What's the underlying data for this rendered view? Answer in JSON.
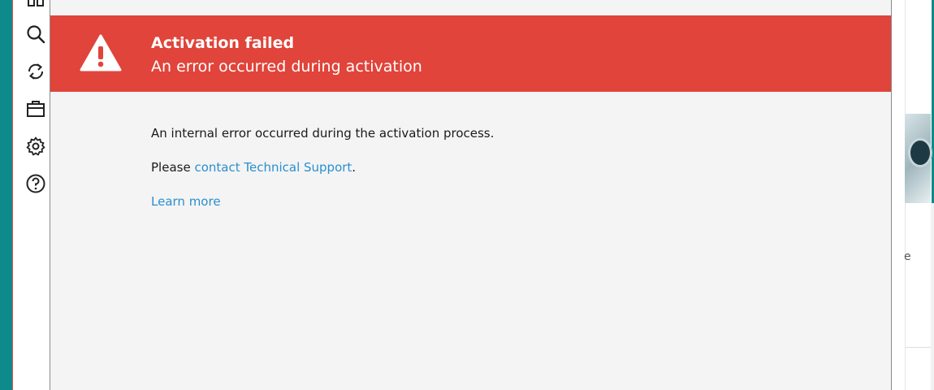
{
  "sidebar": {
    "icons": [
      "dashboard-icon",
      "search-icon",
      "refresh-icon",
      "briefcase-icon",
      "settings-gear-icon",
      "help-question-icon"
    ]
  },
  "background": {
    "partial_letter": "e"
  },
  "dialog": {
    "banner": {
      "title": "Activation failed",
      "subtitle": "An error occurred during activation",
      "color": "#e0443a",
      "icon": "warning-triangle-icon"
    },
    "message": "An internal error occurred during the activation process.",
    "please_prefix": "Please ",
    "support_link": "contact Technical Support",
    "please_suffix": ".",
    "learn_more": "Learn more",
    "link_color": "#2a8fcf"
  }
}
